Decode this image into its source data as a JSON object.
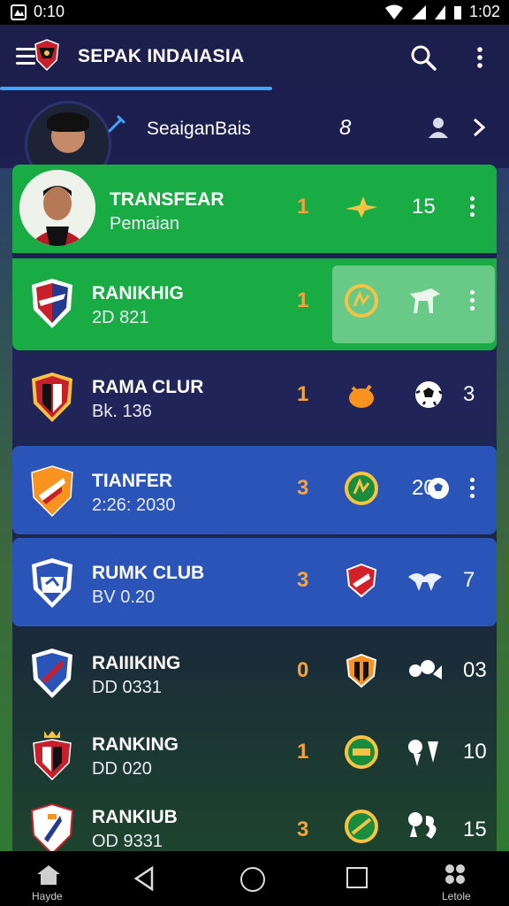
{
  "status": {
    "time_left": "0:10",
    "time_right": "1:02"
  },
  "appbar": {
    "title": "SEPAK INDAIASIA"
  },
  "profile": {
    "name": "SeaiganBais",
    "count": "8"
  },
  "rows": [
    {
      "title": "TRANSFEAR",
      "sub": "Pemaian",
      "num": "1",
      "val": "15",
      "style": "green"
    },
    {
      "title": "RANIKHIG",
      "sub": "2D 821",
      "num": "1",
      "style": "green"
    },
    {
      "title": "RAMA CLUR",
      "sub": "Bk. 136",
      "num": "1",
      "val": "3",
      "style": "dark"
    },
    {
      "title": "TIANFER",
      "sub": "2:26: 2030",
      "num": "3",
      "val": "20",
      "style": "blue"
    },
    {
      "title": "RUMK CLUB",
      "sub": "BV 0.20",
      "num": "3",
      "val": "7",
      "style": "blue"
    },
    {
      "title": "RAIIIKING",
      "sub": "DD 0331",
      "num": "0",
      "val": "03",
      "style": "dark"
    },
    {
      "title": "RANKING",
      "sub": "DD 020",
      "num": "1",
      "val": "10",
      "style": "dark"
    },
    {
      "title": "RANKIUB",
      "sub": "OD 9331",
      "num": "3",
      "val": "15",
      "style": "dark"
    }
  ],
  "icons": {
    "row1": [
      "bird-icon",
      "more-vert-icon"
    ],
    "row2": [
      "crest-icon",
      "horse-icon",
      "more-vert-icon"
    ],
    "row3": [
      "bull-icon",
      "soccer-ball-icon"
    ],
    "row4": [
      "crest-icon",
      "soccer-ball-icon",
      "more-vert-icon"
    ],
    "row5": [
      "shield-icon",
      "bird-icon"
    ],
    "row6": [
      "shield-icon",
      "animal-icon"
    ],
    "row7": [
      "crest-icon",
      "animal-icon"
    ],
    "row8": [
      "crest-icon",
      "animal-icon"
    ]
  },
  "navbar": {
    "home_label": "Hayde",
    "extra_label": "Letole"
  },
  "colors": {
    "green": "#19ac45",
    "blue": "#2a54b8",
    "accent": "#3ea6ff",
    "number": "#f7a23b"
  }
}
